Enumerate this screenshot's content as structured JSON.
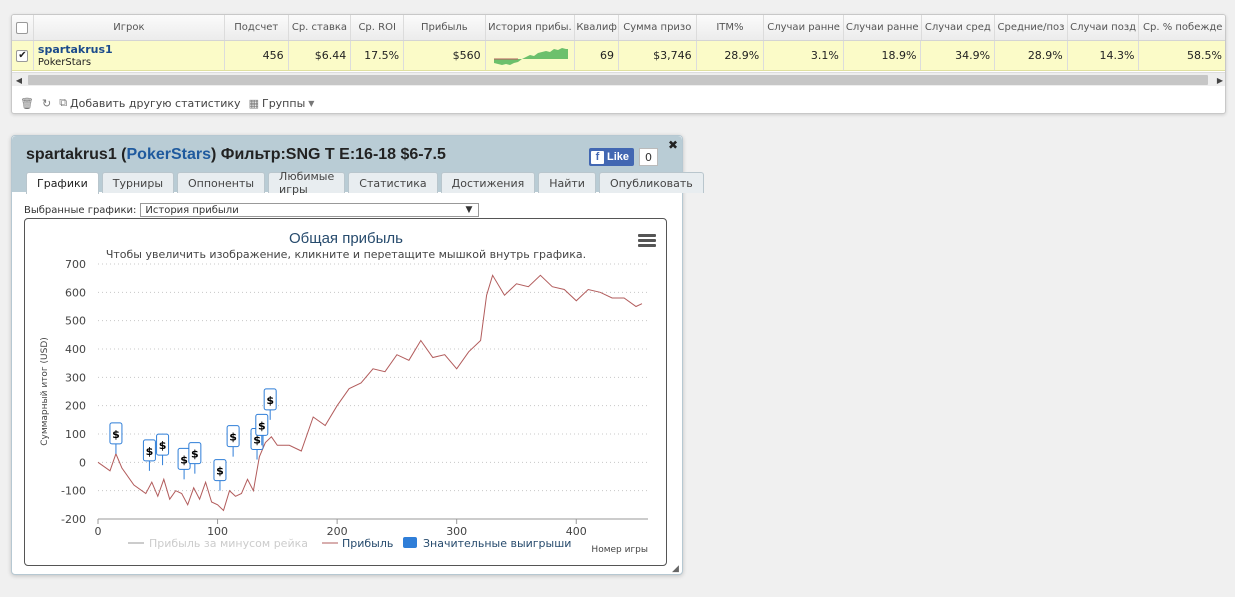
{
  "table": {
    "columns": [
      "Игрок",
      "Подсчет",
      "Ср. ставка",
      "Ср. ROI",
      "Прибыль",
      "История прибы.",
      "Квалиф",
      "Сумма призо",
      "ITM%",
      "Случаи ранне",
      "Случаи ранне",
      "Случаи сред",
      "Средние/поз",
      "Случаи позд",
      "Ср. % побежде"
    ],
    "row": {
      "checked": true,
      "player": "spartakrus1",
      "room": "PokerStars",
      "count": "456",
      "avg_stake": "$6.44",
      "avg_roi": "17.5%",
      "profit": "$560",
      "qualif": "69",
      "prize_sum": "$3,746",
      "itm": "28.9%",
      "early1": "3.1%",
      "early2": "18.9%",
      "mid": "34.9%",
      "midpos": "28.9%",
      "late": "14.3%",
      "win_pct": "58.5%"
    }
  },
  "toolbar": {
    "add_stat": "Добавить другую статистику",
    "groups": "Группы"
  },
  "panel": {
    "title_player": "spartakrus1",
    "title_room": "PokerStars",
    "title_filter": "Фильтр:SNG T E:16-18 $6-7.5",
    "fb_like": "Like",
    "fb_count": "0",
    "tabs": [
      "Графики",
      "Турниры",
      "Оппоненты",
      "Любимые игры",
      "Статистика",
      "Достижения",
      "Найти",
      "Опубликовать"
    ],
    "select_label": "Выбранные графики:",
    "select_value": "История прибыли"
  },
  "colors": {
    "profit_line": "#b25c5c",
    "big_win": "#2f7ed8",
    "rake_line": "#cccccc",
    "spark_fill": "#6cc06c"
  },
  "chart_data": {
    "type": "line",
    "title": "Общая прибыль",
    "subtitle": "Чтобы увеличить изображение, кликните и перетащите мышкой внутрь графика.",
    "xlabel": "Номер игры",
    "ylabel": "Суммарный итог (USD)",
    "xlim": [
      0,
      460
    ],
    "ylim": [
      -200,
      700
    ],
    "xticks": [
      0,
      100,
      200,
      300,
      400
    ],
    "yticks": [
      -200,
      -100,
      0,
      100,
      200,
      300,
      400,
      500,
      600,
      700
    ],
    "legend": [
      "Прибыль за минусом рейка",
      "Прибыль",
      "Значительные выигрыши"
    ],
    "series": [
      {
        "name": "Прибыль",
        "x": [
          0,
          10,
          15,
          20,
          30,
          40,
          45,
          50,
          55,
          60,
          65,
          70,
          75,
          80,
          85,
          90,
          95,
          100,
          105,
          110,
          115,
          120,
          125,
          130,
          135,
          140,
          145,
          150,
          160,
          170,
          180,
          190,
          200,
          210,
          220,
          230,
          240,
          250,
          260,
          270,
          280,
          290,
          300,
          310,
          320,
          325,
          330,
          340,
          350,
          360,
          370,
          380,
          390,
          400,
          410,
          420,
          430,
          440,
          450,
          455
        ],
        "y": [
          0,
          -30,
          30,
          -20,
          -80,
          -110,
          -70,
          -120,
          -60,
          -130,
          -100,
          -110,
          -150,
          -90,
          -130,
          -70,
          -140,
          -150,
          -170,
          -100,
          -120,
          -110,
          -60,
          -100,
          20,
          70,
          90,
          60,
          60,
          40,
          160,
          130,
          200,
          260,
          280,
          330,
          320,
          380,
          360,
          430,
          370,
          380,
          330,
          390,
          430,
          590,
          660,
          590,
          630,
          620,
          660,
          620,
          610,
          570,
          610,
          600,
          580,
          580,
          550,
          560
        ]
      }
    ],
    "big_wins": [
      {
        "x": 15,
        "y": 30
      },
      {
        "x": 43,
        "y": -30
      },
      {
        "x": 54,
        "y": -10
      },
      {
        "x": 72,
        "y": -60
      },
      {
        "x": 81,
        "y": -40
      },
      {
        "x": 102,
        "y": -100
      },
      {
        "x": 113,
        "y": 20
      },
      {
        "x": 133,
        "y": 10
      },
      {
        "x": 137,
        "y": 60
      },
      {
        "x": 144,
        "y": 150
      }
    ],
    "big_win_label": "$"
  }
}
